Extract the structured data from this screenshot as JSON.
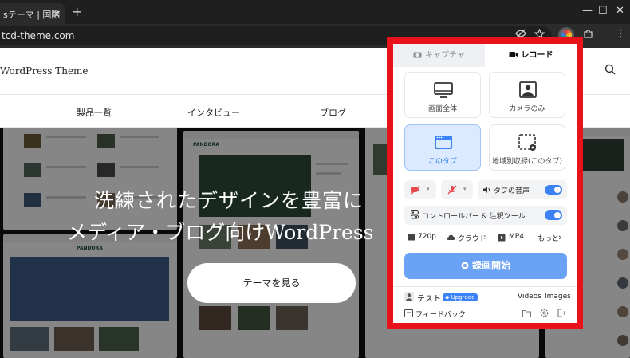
{
  "browser": {
    "tab_title": "sテーマ | 国際",
    "tab_close": "✕",
    "new_tab": "+",
    "minimize": "—",
    "maximize": "☐",
    "close": "✕",
    "url": "tcd-theme.com",
    "menu_icon": "⋮"
  },
  "site": {
    "logo": "WordPress Theme",
    "nav": [
      "製品一覧",
      "インタビュー",
      "ブログ"
    ],
    "hero_title": "洗練されたデザインを豊富に",
    "hero_sub": "メディア・ブログ向けWordPress",
    "hero_button": "テーマを見る",
    "preview_brand": "PANDORA"
  },
  "popup": {
    "tabs": {
      "capture": "キャプチャ",
      "record": "レコード"
    },
    "modes": [
      {
        "label": "画面全体",
        "icon": "monitor-icon"
      },
      {
        "label": "カメラのみ",
        "icon": "camera-person-icon"
      },
      {
        "label": "このタブ",
        "icon": "browser-tab-icon",
        "selected": true
      },
      {
        "label": "地域別収録(このタブ)",
        "icon": "region-select-icon"
      }
    ],
    "tab_audio_label": "タブの音声",
    "control_bar_label": "コントロールバー & 注釈ツール",
    "quality": "720p",
    "storage": "クラウド",
    "format": "MP4",
    "more": "もっと",
    "start_button": "録画開始",
    "user_name": "テスト",
    "upgrade": "Upgrade",
    "videos": "Videos",
    "images": "Images",
    "feedback": "フィードバック",
    "colors": {
      "accent": "#3b82f6",
      "frame": "#e8121a",
      "mic_off": "#e5484d"
    }
  }
}
